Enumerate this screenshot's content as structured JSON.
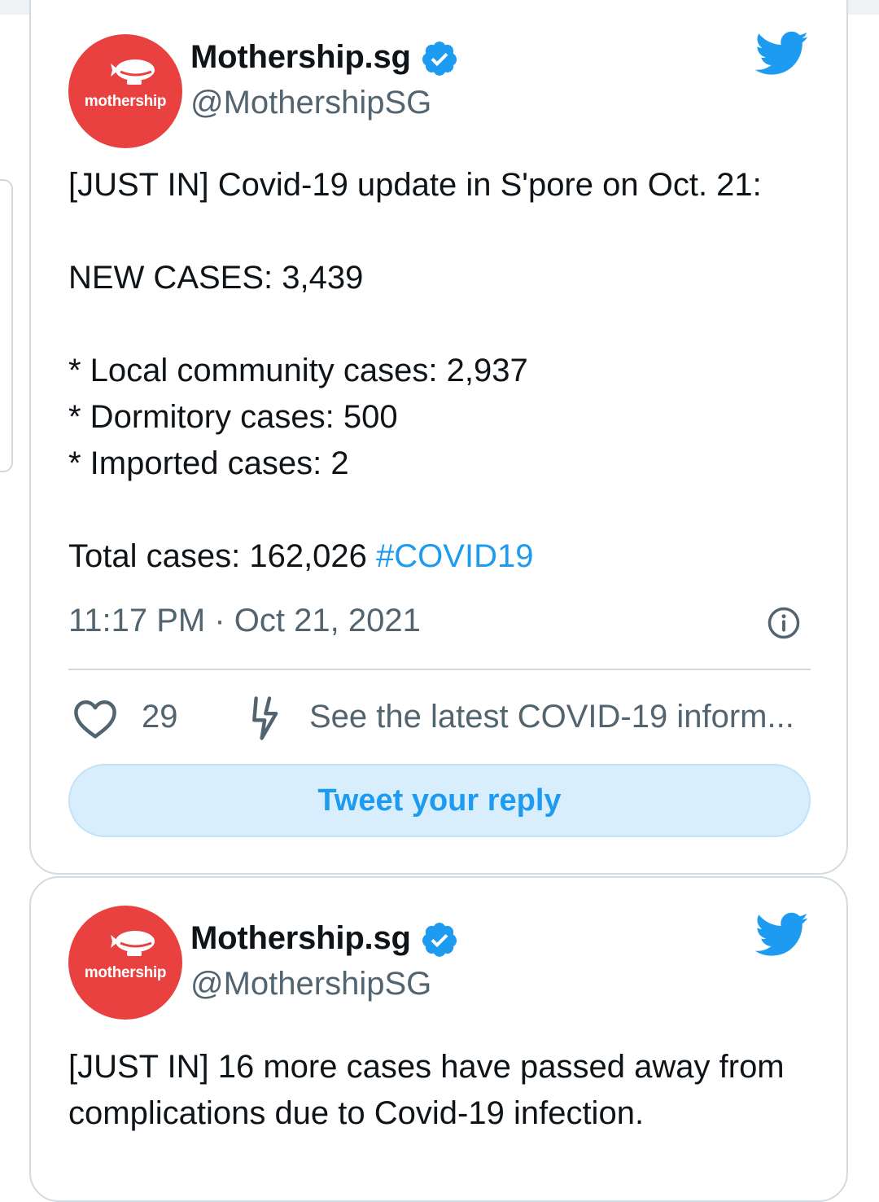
{
  "tweets": [
    {
      "account": {
        "avatar_text": "mothership",
        "display_name": "Mothership.sg",
        "handle": "@MothershipSG",
        "verified": true,
        "brand_color": "#e8413f"
      },
      "text_lines": {
        "headline": "[JUST IN] Covid-19 update in S'pore on Oct. 21:",
        "new_cases": "NEW CASES: 3,439",
        "local": "* Local community cases: 2,937",
        "dormitory": "* Dormitory cases: 500",
        "imported": "* Imported cases: 2",
        "total": "Total cases: 162,026 ",
        "hashtag": "#COVID19"
      },
      "timestamp": "11:17 PM · Oct 21, 2021",
      "like_count": "29",
      "covid_link": "See the latest COVID-19 inform...",
      "reply_label": "Tweet your reply"
    },
    {
      "account": {
        "avatar_text": "mothership",
        "display_name": "Mothership.sg",
        "handle": "@MothershipSG",
        "verified": true
      },
      "text_lines": {
        "line1": "[JUST IN] 16 more cases have passed away from",
        "line2": "complications due to Covid-19 infection."
      }
    }
  ],
  "colors": {
    "accent": "#1d9bf0",
    "text": "#0f1419",
    "muted": "#536471"
  },
  "icons": [
    "twitter-bird-icon",
    "verified-badge-icon",
    "info-icon",
    "heart-icon",
    "lightning-bolt-icon"
  ]
}
